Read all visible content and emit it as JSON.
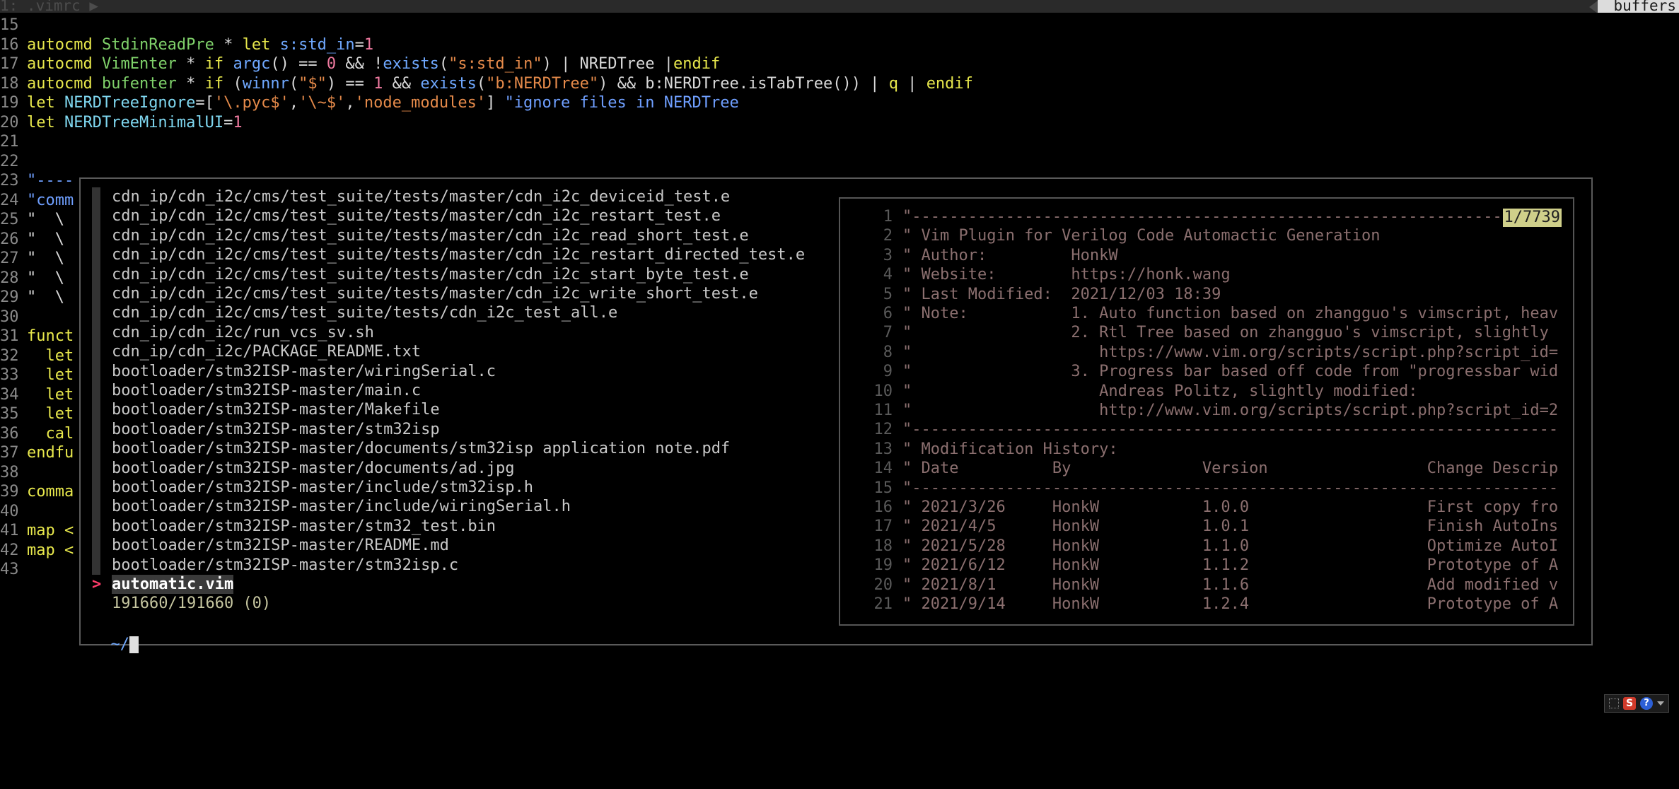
{
  "tabline": {
    "left": "1: .vimrc ▶",
    "right": "buffers"
  },
  "editor_lines": [
    {
      "num": "15",
      "segs": []
    },
    {
      "num": "16",
      "segs": [
        {
          "t": "autocmd ",
          "c": "k"
        },
        {
          "t": "StdinReadPre",
          "c": "g"
        },
        {
          "t": " * ",
          "c": "w"
        },
        {
          "t": "let ",
          "c": "k"
        },
        {
          "t": "s:std_in",
          "c": "f"
        },
        {
          "t": "=",
          "c": "w"
        },
        {
          "t": "1",
          "c": "n"
        }
      ]
    },
    {
      "num": "17",
      "segs": [
        {
          "t": "autocmd ",
          "c": "k"
        },
        {
          "t": "VimEnter",
          "c": "g"
        },
        {
          "t": " * ",
          "c": "w"
        },
        {
          "t": "if ",
          "c": "k"
        },
        {
          "t": "argc",
          "c": "f"
        },
        {
          "t": "() == ",
          "c": "w"
        },
        {
          "t": "0",
          "c": "n"
        },
        {
          "t": " && !",
          "c": "w"
        },
        {
          "t": "exists",
          "c": "f"
        },
        {
          "t": "(",
          "c": "w"
        },
        {
          "t": "\"s:std_in\"",
          "c": "s"
        },
        {
          "t": ") | NREDTree |",
          "c": "w"
        },
        {
          "t": "endif",
          "c": "k"
        }
      ]
    },
    {
      "num": "18",
      "segs": [
        {
          "t": "autocmd ",
          "c": "k"
        },
        {
          "t": "bufenter",
          "c": "g"
        },
        {
          "t": " * ",
          "c": "w"
        },
        {
          "t": "if ",
          "c": "k"
        },
        {
          "t": "(",
          "c": "w"
        },
        {
          "t": "winnr",
          "c": "f"
        },
        {
          "t": "(",
          "c": "w"
        },
        {
          "t": "\"$\"",
          "c": "s"
        },
        {
          "t": ") == ",
          "c": "w"
        },
        {
          "t": "1",
          "c": "n"
        },
        {
          "t": " && ",
          "c": "w"
        },
        {
          "t": "exists",
          "c": "f"
        },
        {
          "t": "(",
          "c": "w"
        },
        {
          "t": "\"b:NERDTree\"",
          "c": "s"
        },
        {
          "t": ") && b:NERDTree.isTabTree()) | ",
          "c": "w"
        },
        {
          "t": "q",
          "c": "k"
        },
        {
          "t": " | ",
          "c": "w"
        },
        {
          "t": "endif",
          "c": "k"
        }
      ]
    },
    {
      "num": "19",
      "segs": [
        {
          "t": "let ",
          "c": "k"
        },
        {
          "t": "NERDTreeIgnore",
          "c": "id"
        },
        {
          "t": "=[",
          "c": "w"
        },
        {
          "t": "'\\.pyc$'",
          "c": "s"
        },
        {
          "t": ",",
          "c": "w"
        },
        {
          "t": "'\\~$'",
          "c": "s"
        },
        {
          "t": ",",
          "c": "w"
        },
        {
          "t": "'node_modules'",
          "c": "s"
        },
        {
          "t": "] ",
          "c": "w"
        },
        {
          "t": "\"ignore files in NERDTree",
          "c": "cm"
        }
      ]
    },
    {
      "num": "20",
      "segs": [
        {
          "t": "let ",
          "c": "k"
        },
        {
          "t": "NERDTreeMinimalUI",
          "c": "id"
        },
        {
          "t": "=",
          "c": "w"
        },
        {
          "t": "1",
          "c": "n"
        }
      ]
    },
    {
      "num": "21",
      "segs": []
    },
    {
      "num": "22",
      "segs": []
    },
    {
      "num": "23",
      "segs": [
        {
          "t": "\"----",
          "c": "cm"
        }
      ]
    },
    {
      "num": "24",
      "segs": [
        {
          "t": "\"comm",
          "c": "cm"
        }
      ]
    },
    {
      "num": "25",
      "segs": [
        {
          "t": "\"  \\",
          "c": "w"
        }
      ]
    },
    {
      "num": "26",
      "segs": [
        {
          "t": "\"  \\",
          "c": "w"
        }
      ]
    },
    {
      "num": "27",
      "segs": [
        {
          "t": "\"  \\",
          "c": "w"
        }
      ]
    },
    {
      "num": "28",
      "segs": [
        {
          "t": "\"  \\",
          "c": "w"
        }
      ]
    },
    {
      "num": "29",
      "segs": [
        {
          "t": "\"  \\",
          "c": "w"
        }
      ]
    },
    {
      "num": "30",
      "segs": []
    },
    {
      "num": "31",
      "segs": [
        {
          "t": "funct",
          "c": "k"
        }
      ]
    },
    {
      "num": "32",
      "segs": [
        {
          "t": "  let",
          "c": "k"
        }
      ]
    },
    {
      "num": "33",
      "segs": [
        {
          "t": "  let",
          "c": "k"
        }
      ]
    },
    {
      "num": "34",
      "segs": [
        {
          "t": "  let",
          "c": "k"
        }
      ]
    },
    {
      "num": "35",
      "segs": [
        {
          "t": "  let",
          "c": "k"
        }
      ]
    },
    {
      "num": "36",
      "segs": [
        {
          "t": "  cal",
          "c": "k"
        }
      ]
    },
    {
      "num": "37",
      "segs": [
        {
          "t": "endfu",
          "c": "k"
        }
      ]
    },
    {
      "num": "38",
      "segs": []
    },
    {
      "num": "39",
      "segs": [
        {
          "t": "comma",
          "c": "k"
        }
      ]
    },
    {
      "num": "40",
      "segs": []
    },
    {
      "num": "41",
      "segs": [
        {
          "t": "map <",
          "c": "k"
        }
      ]
    },
    {
      "num": "42",
      "segs": [
        {
          "t": "map <",
          "c": "k"
        }
      ]
    },
    {
      "num": "43",
      "segs": []
    }
  ],
  "results": [
    "cdn_ip/cdn_i2c/cms/test_suite/tests/master/cdn_i2c_deviceid_test.e",
    "cdn_ip/cdn_i2c/cms/test_suite/tests/master/cdn_i2c_restart_test.e",
    "cdn_ip/cdn_i2c/cms/test_suite/tests/master/cdn_i2c_read_short_test.e",
    "cdn_ip/cdn_i2c/cms/test_suite/tests/master/cdn_i2c_restart_directed_test.e",
    "cdn_ip/cdn_i2c/cms/test_suite/tests/master/cdn_i2c_start_byte_test.e",
    "cdn_ip/cdn_i2c/cms/test_suite/tests/master/cdn_i2c_write_short_test.e",
    "cdn_ip/cdn_i2c/cms/test_suite/tests/cdn_i2c_test_all.e",
    "cdn_ip/cdn_i2c/run_vcs_sv.sh",
    "cdn_ip/cdn_i2c/PACKAGE_README.txt",
    "bootloader/stm32ISP-master/wiringSerial.c",
    "bootloader/stm32ISP-master/main.c",
    "bootloader/stm32ISP-master/Makefile",
    "bootloader/stm32ISP-master/stm32isp",
    "bootloader/stm32ISP-master/documents/stm32isp application note.pdf",
    "bootloader/stm32ISP-master/documents/ad.jpg",
    "bootloader/stm32ISP-master/include/stm32isp.h",
    "bootloader/stm32ISP-master/include/wiringSerial.h",
    "bootloader/stm32ISP-master/stm32_test.bin",
    "bootloader/stm32ISP-master/README.md",
    "bootloader/stm32ISP-master/stm32isp.c"
  ],
  "selected": {
    "caret": ">",
    "label": "automatic.vim"
  },
  "match_count": "191660/191660 (0)",
  "prompt": {
    "text": "~/"
  },
  "preview": {
    "badge": "1/7739",
    "lines": [
      {
        "n": "1",
        "t": "\"-----------------------------------------------------------------"
      },
      {
        "n": "2",
        "t": "\" Vim Plugin for Verilog Code Automactic Generation"
      },
      {
        "n": "3",
        "t": "\" Author:         HonkW"
      },
      {
        "n": "4",
        "t": "\" Website:        https://honk.wang"
      },
      {
        "n": "5",
        "t": "\" Last Modified:  2021/12/03 18:39"
      },
      {
        "n": "6",
        "t": "\" Note:           1. Auto function based on zhangguo's vimscript, heav"
      },
      {
        "n": "7",
        "t": "\"                 2. Rtl Tree based on zhangguo's vimscript, slightly"
      },
      {
        "n": "8",
        "t": "\"                    https://www.vim.org/scripts/script.php?script_id="
      },
      {
        "n": "9",
        "t": "\"                 3. Progress bar based off code from \"progressbar wid"
      },
      {
        "n": "10",
        "t": "\"                    Andreas Politz, slightly modified:"
      },
      {
        "n": "11",
        "t": "\"                    http://www.vim.org/scripts/script.php?script_id=2"
      },
      {
        "n": "12",
        "t": "\"---------------------------------------------------------------------"
      },
      {
        "n": "13",
        "t": "\" Modification History:"
      },
      {
        "n": "14",
        "t": "\" Date          By              Version                 Change Descrip"
      },
      {
        "n": "15",
        "t": "\"---------------------------------------------------------------------"
      },
      {
        "n": "16",
        "t": "\" 2021/3/26     HonkW           1.0.0                   First copy fro"
      },
      {
        "n": "17",
        "t": "\" 2021/4/5      HonkW           1.0.1                   Finish AutoIns"
      },
      {
        "n": "18",
        "t": "\" 2021/5/28     HonkW           1.1.0                   Optimize AutoI"
      },
      {
        "n": "19",
        "t": "\" 2021/6/12     HonkW           1.1.2                   Prototype of A"
      },
      {
        "n": "20",
        "t": "\" 2021/8/1      HonkW           1.1.6                   Add modified v"
      },
      {
        "n": "21",
        "t": "\" 2021/9/14     HonkW           1.2.4                   Prototype of A"
      }
    ]
  },
  "tray": {
    "s_label": "S",
    "help_label": "?"
  },
  "icons": {
    "tray_dots": "grip-icon",
    "tray_s": "sogou-ime-icon",
    "tray_help": "help-icon",
    "tray_dropdown": "chevron-down-icon"
  }
}
